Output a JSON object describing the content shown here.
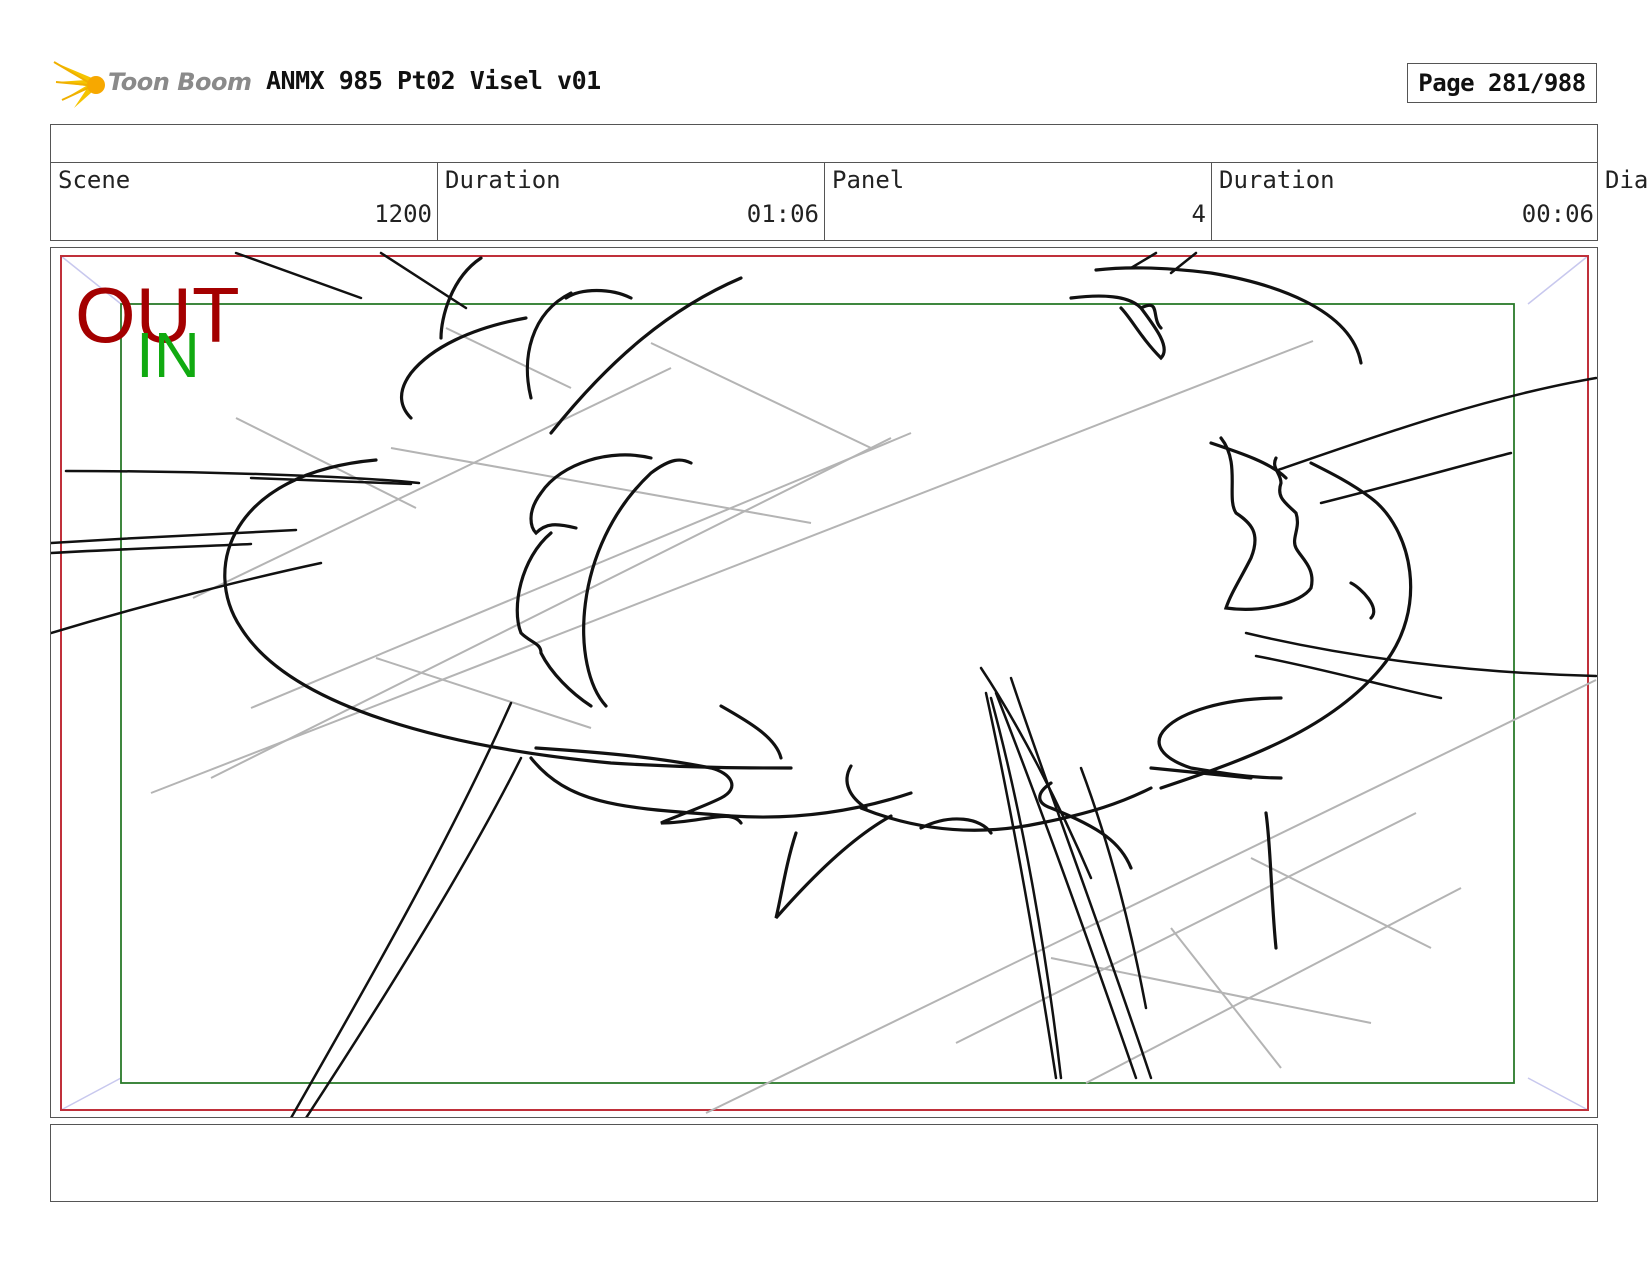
{
  "header": {
    "logo_text": "Toon Boom",
    "title": "ANMX 985 Pt02 Visel v01",
    "page_label": "Page 281/988"
  },
  "info": {
    "scene_label": "Scene",
    "scene_value": "1200",
    "scene_duration_label": "Duration",
    "scene_duration_value": "01:06",
    "panel_label": "Panel",
    "panel_value": "4",
    "panel_duration_label": "Duration",
    "panel_duration_value": "00:06",
    "dialog_label": "Dia"
  },
  "panel": {
    "out_label": "OUT",
    "in_label": "IN",
    "colors": {
      "out_frame": "#c0303a",
      "in_frame": "#2a7a2a",
      "corner_lines": "#c8c8ee",
      "sketch": "#111111",
      "guide": "#b4b4b4"
    }
  },
  "icons": {
    "logo": "starburst-logo-icon"
  }
}
